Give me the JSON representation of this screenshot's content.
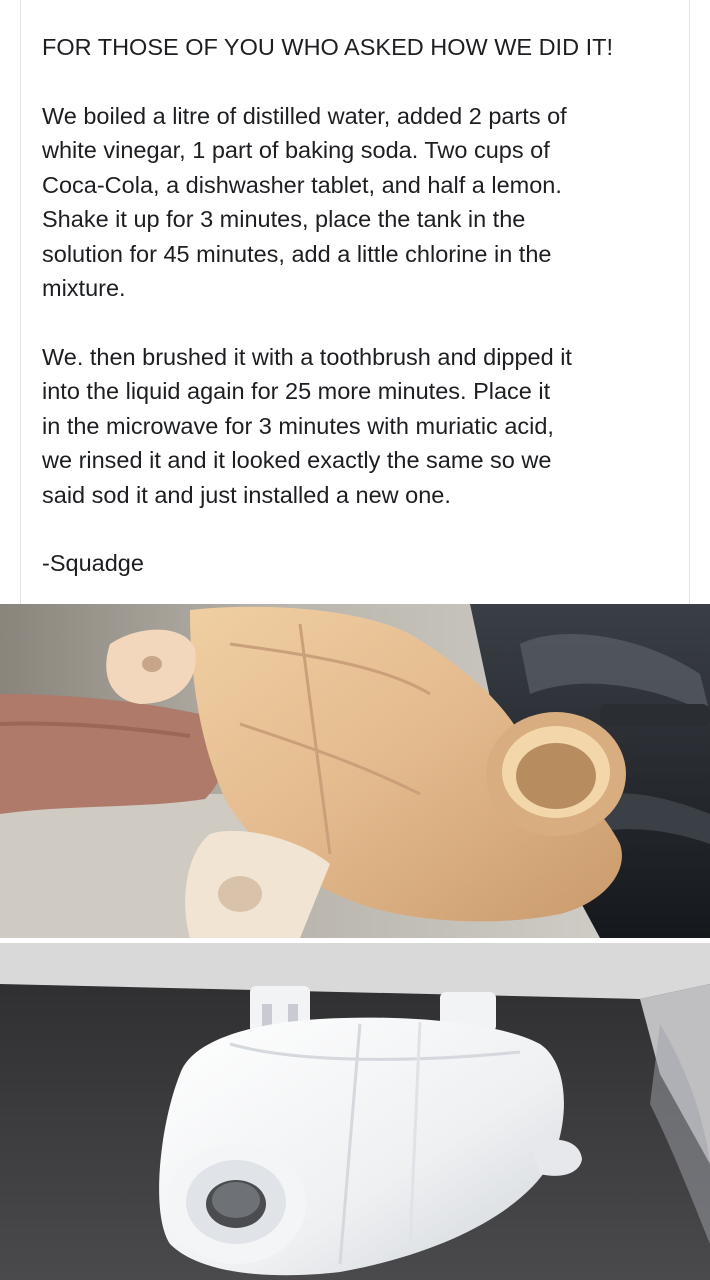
{
  "post": {
    "heading": "FOR THOSE OF YOU WHO ASKED HOW WE DID IT!",
    "paragraph1": "We boiled a litre of distilled water, added 2 parts of\nwhite vinegar, 1 part of baking soda. Two cups of\nCoca-Cola, a dishwasher tablet, and half a lemon.\nShake it up for 3 minutes, place the tank in the\nsolution for 45 minutes, add a little chlorine in the\nmixture.",
    "paragraph2": "We. then brushed it with a toothbrush and dipped it\ninto the liquid again for 25 more minutes. Place it\nin the microwave for 3 minutes with muriatic acid,\nwe rinsed it and it looked exactly the same so we\nsaid sod it and just installed a new one.",
    "signature": "-Squadge"
  },
  "photos": {
    "top_photo": "old-yellowed-coolant-tank",
    "bottom_photo": "new-white-coolant-tank"
  },
  "colors": {
    "text": "#1c1e21",
    "card_border": "#e3e3e3",
    "old_tank": "#e2b98c",
    "new_tank": "#eef0f2"
  }
}
